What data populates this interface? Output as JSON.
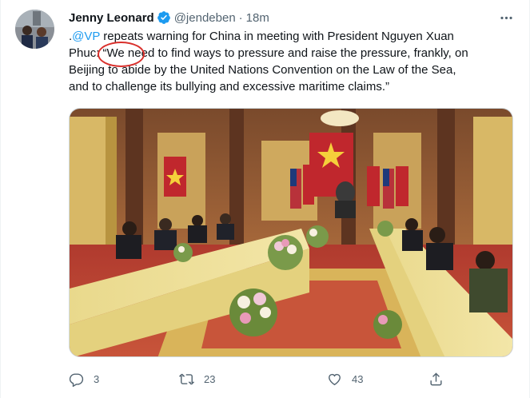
{
  "tweet": {
    "author_name": "Jenny Leonard",
    "handle": "@jendeben",
    "separator": "·",
    "timestamp": "18m",
    "text": {
      "prefix": ".",
      "mention": "@VP",
      "line1_rest": " repeats warning for China in meeting with President Nguyen Xuan",
      "line2": "Phuc: “We need to find ways to pressure and raise the pressure, frankly, on",
      "line3": "Beijing to abide by the United Nations Convention on the Law of the Sea,",
      "line4": "and to challenge its bullying and excessive maritime claims.”"
    },
    "verified": true
  },
  "icons": {
    "more": "more-icon",
    "verified": "verified-badge-icon",
    "reply": "reply-icon",
    "retweet": "retweet-icon",
    "like": "like-icon",
    "share": "share-icon"
  },
  "actions": {
    "reply_count": "3",
    "retweet_count": "23",
    "like_count": "43"
  },
  "colors": {
    "accent": "#1d9bf0",
    "text": "#0f1419",
    "secondary": "#536471",
    "annotation": "#d9302c"
  }
}
